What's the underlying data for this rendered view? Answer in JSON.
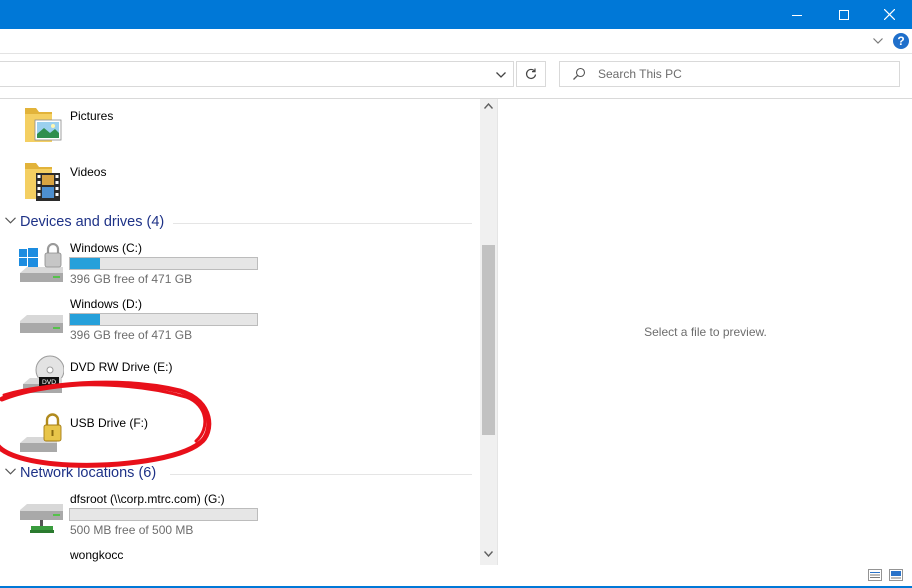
{
  "window": {
    "controls": {
      "minimize": "minimize-icon",
      "maximize": "maximize-icon",
      "close": "close-icon"
    },
    "accent": "#0078d7"
  },
  "ribbon": {
    "help_label": "?"
  },
  "address": {
    "value": ""
  },
  "search": {
    "placeholder": "Search This PC"
  },
  "folders": [
    {
      "name": "Pictures",
      "icon": "pictures-folder-icon"
    },
    {
      "name": "Videos",
      "icon": "videos-folder-icon"
    }
  ],
  "devices_group": {
    "label": "Devices and drives (4)",
    "items": [
      {
        "name": "Windows (C:)",
        "space": "396 GB free of 471 GB",
        "used_fraction": 0.16,
        "icon": "windows-drive-icon"
      },
      {
        "name": "Windows (D:)",
        "space": "396 GB free of 471 GB",
        "used_fraction": 0.16,
        "icon": "hard-drive-icon"
      },
      {
        "name": "DVD RW Drive (E:)",
        "icon": "dvd-drive-icon"
      },
      {
        "name": "USB Drive (F:)",
        "icon": "locked-usb-drive-icon"
      }
    ]
  },
  "network_group": {
    "label": "Network locations (6)",
    "items": [
      {
        "name": "dfsroot (\\\\corp.mtrc.com) (G:)",
        "space": "500 MB free of 500 MB",
        "used_fraction": 0.0,
        "icon": "network-drive-icon"
      },
      {
        "name": "wongkocc",
        "icon": "network-drive-icon"
      }
    ]
  },
  "preview": {
    "text": "Select a file to preview."
  },
  "colors": {
    "bar_fill": "#26a0da",
    "group_label": "#1e3287",
    "annotation": "#e8101a"
  }
}
